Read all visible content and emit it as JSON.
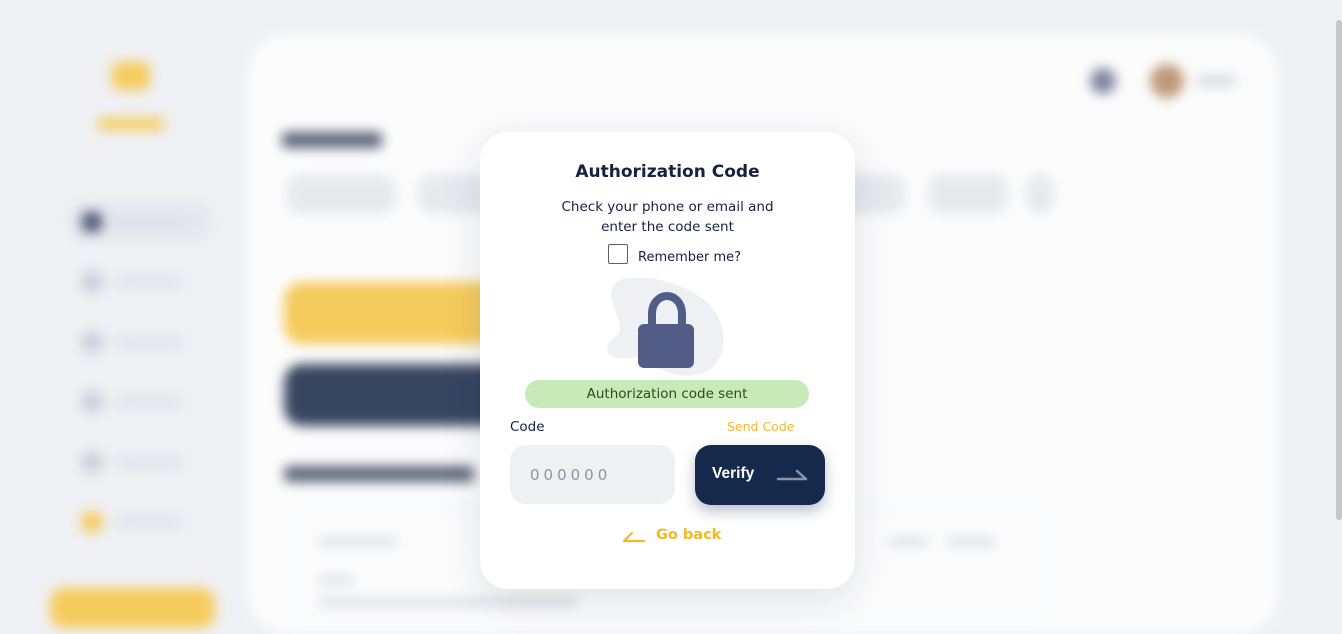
{
  "modal": {
    "title": "Authorization Code",
    "description_line1": "Check your phone or email and",
    "description_line2": "enter the code sent",
    "remember_label": "Remember me?",
    "remember_checked": false,
    "status_message": "Authorization code sent",
    "code_label": "Code",
    "send_code_label": "Send Code",
    "code_placeholder": "000000",
    "code_value": "",
    "verify_label": "Verify",
    "go_back_label": "Go back"
  },
  "icons": {
    "lock": "lock-icon",
    "verify_arrow": "arrow-right-icon",
    "back_arrow": "arrow-left-icon"
  },
  "colors": {
    "accent": "#f6b727",
    "navy": "#15294c",
    "success_bg": "#c8eab8",
    "lock": "#525d87"
  }
}
